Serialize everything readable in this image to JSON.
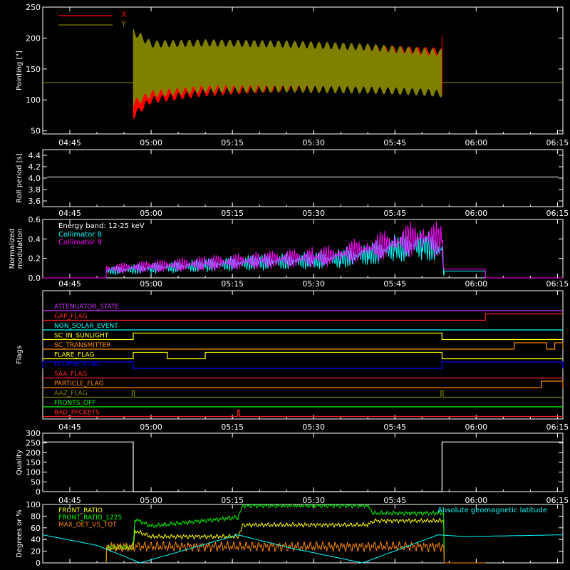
{
  "chart_data": [
    {
      "id": "pointing",
      "type": "line",
      "ylabel": "Pointing [\"]",
      "ylim": [
        45,
        250
      ],
      "yticks": [
        50,
        100,
        150,
        200,
        250
      ],
      "xticks": [
        "04:45",
        "05:00",
        "05:15",
        "05:30",
        "05:45",
        "06:00",
        "06:15"
      ],
      "xlim": [
        0,
        96
      ],
      "legend": {
        "placement": "top-left"
      },
      "series": [
        {
          "name": "X",
          "color": "#ff0000",
          "envelope": {
            "x": [
              16.7,
              20,
              30,
              45,
              60,
              70,
              73.7
            ],
            "hi": [
              205,
              180,
              183,
              180,
              181,
              180,
              178
            ],
            "lo": [
              75,
              100,
              112,
              120,
              124,
              127,
              128
            ]
          }
        },
        {
          "name": "Y",
          "color": "#808000",
          "envelope": {
            "x": [
              16.7,
              20,
              30,
              45,
              60,
              70,
              73.7
            ],
            "hi": [
              210,
              190,
              192,
              190,
              185,
              178,
              176
            ],
            "lo": [
              95,
              110,
              118,
              118,
              116,
              113,
              110
            ]
          }
        }
      ],
      "baseline": {
        "color": "#808000",
        "value": 128
      }
    },
    {
      "id": "roll",
      "type": "line",
      "ylabel": "Roll period [s]",
      "ylim": [
        3.5,
        4.5
      ],
      "yticks": [
        "3.6",
        "3.8",
        "4.0",
        "4.2",
        "4.4"
      ],
      "xticks": [
        "04:45",
        "05:00",
        "05:15",
        "05:30",
        "05:45",
        "06:00",
        "06:15"
      ],
      "series": [
        {
          "color": "#ffffff",
          "value": 4.02
        }
      ]
    },
    {
      "id": "modulation",
      "type": "line",
      "ylabel": "Normalized modulation",
      "ylim": [
        0,
        0.6
      ],
      "yticks": [
        "0.0",
        "0.2",
        "0.4",
        "0.6"
      ],
      "xticks": [
        "04:45",
        "05:00",
        "05:15",
        "05:30",
        "05:45",
        "06:00",
        "06:15"
      ],
      "annotations": [
        "Energy band: 12-25 keV"
      ],
      "series": [
        {
          "name": "Collimator 8",
          "color": "#00ffff",
          "x": [
            11.7,
            20,
            30,
            40,
            50,
            55,
            60,
            65,
            70,
            73.7,
            74,
            81.7
          ],
          "y": [
            0.07,
            0.1,
            0.13,
            0.16,
            0.18,
            0.2,
            0.24,
            0.3,
            0.34,
            0.28,
            0.07,
            0.07
          ]
        },
        {
          "name": "Collimator 9",
          "color": "#ff00ff",
          "x": [
            11.7,
            20,
            30,
            40,
            50,
            55,
            60,
            65,
            70,
            73.7,
            74,
            81.7
          ],
          "y": [
            0.09,
            0.12,
            0.15,
            0.18,
            0.21,
            0.24,
            0.3,
            0.36,
            0.42,
            0.38,
            0.09,
            0.09
          ]
        }
      ],
      "start_x": 11.7,
      "end_x": 81.7
    },
    {
      "id": "flags",
      "type": "line",
      "ylabel": "Flags",
      "xticks": [
        "04:45",
        "05:00",
        "05:15",
        "05:30",
        "05:45",
        "06:00",
        "06:15"
      ],
      "series": [
        {
          "name": "ATTENUATOR_STATE",
          "color": "#cc33ff",
          "steps": []
        },
        {
          "name": "GAP_FLAG",
          "color": "#ff2222",
          "steps": [
            [
              11.7,
              81.7
            ]
          ],
          "invert": true
        },
        {
          "name": "NON_SOLAR_EVENT",
          "color": "#00ffff",
          "steps": []
        },
        {
          "name": "SC_IN_SUNLIGHT",
          "color": "#ffff00",
          "steps": [
            [
              16.7,
              73.7
            ]
          ]
        },
        {
          "name": "SC_TRANSMITTER",
          "color": "#ff8800",
          "steps": [
            [
              87,
              93
            ],
            [
              94.5,
              96
            ]
          ]
        },
        {
          "name": "FLARE_FLAG",
          "color": "#ffff00",
          "steps": [
            [
              16.7,
              23
            ],
            [
              30,
              73.7
            ]
          ]
        },
        {
          "name": "ECLIPSE_FLAG",
          "color": "#0000ff",
          "steps": [
            [
              0,
              16.7
            ],
            [
              73.7,
              96
            ]
          ]
        },
        {
          "name": "SAA_FLAG",
          "color": "#ff2222",
          "steps": []
        },
        {
          "name": "PARTICLE_FLAG",
          "color": "#ff8800",
          "steps": [
            [
              92,
              96
            ]
          ]
        },
        {
          "name": "AAZ_FLAG",
          "color": "#808000",
          "steps": [
            [
              16.5,
              16.9
            ],
            [
              73.5,
              73.9
            ]
          ]
        },
        {
          "name": "FRONTS_OFF",
          "color": "#00ff00",
          "steps": []
        },
        {
          "name": "BAD_PACKETS",
          "color": "#ff2222",
          "steps": [
            [
              36,
              36.3
            ]
          ]
        }
      ]
    },
    {
      "id": "quality",
      "type": "line",
      "ylabel": "Quality",
      "ylim": [
        0,
        300
      ],
      "yticks": [
        "0",
        "50",
        "100",
        "150",
        "200",
        "250",
        "300"
      ],
      "xticks": [
        "04:45",
        "05:00",
        "05:15",
        "05:30",
        "05:45",
        "06:00",
        "06:15"
      ],
      "series": [
        {
          "color": "#ffffff",
          "x": [
            0,
            16.7,
            16.7,
            73.7,
            73.7,
            96
          ],
          "y": [
            255,
            255,
            0,
            0,
            255,
            255
          ]
        }
      ]
    },
    {
      "id": "fronts",
      "type": "line",
      "ylabel": "Degrees or %",
      "ylim": [
        0,
        100
      ],
      "yticks": [
        "0",
        "20",
        "40",
        "60",
        "80",
        "100"
      ],
      "series": [
        {
          "name": "FRONT_RATIO",
          "color": "#ffff00",
          "x": [
            11.7,
            11.8,
            16.7,
            17,
            20,
            36,
            37,
            60,
            61,
            74,
            74.1,
            81.7
          ],
          "y": [
            0,
            25,
            25,
            55,
            45,
            45,
            65,
            65,
            72,
            72,
            0,
            0
          ]
        },
        {
          "name": "FRONT_RATIO_1225",
          "color": "#00ff00",
          "x": [
            11.7,
            11.8,
            16.7,
            17,
            20,
            36,
            37,
            60,
            61,
            74,
            74.1,
            81.7
          ],
          "y": [
            0,
            28,
            28,
            75,
            63,
            78,
            98,
            98,
            85,
            85,
            0,
            0
          ]
        },
        {
          "name": "MAX_DET_VS_TOT",
          "color": "#ff8800",
          "x": [
            11.7,
            11.8,
            74,
            74.1,
            81.7
          ],
          "y": [
            0,
            28,
            28,
            0,
            0
          ]
        },
        {
          "name": "Absolute geomagnetic latitude",
          "color": "#00ffff",
          "x": [
            0,
            10,
            18,
            36,
            46,
            59,
            73,
            78,
            96
          ],
          "y": [
            48,
            30,
            0,
            48,
            25,
            0,
            48,
            45,
            48
          ]
        }
      ],
      "legend_right": "Absolute geomagnetic latitude"
    }
  ]
}
